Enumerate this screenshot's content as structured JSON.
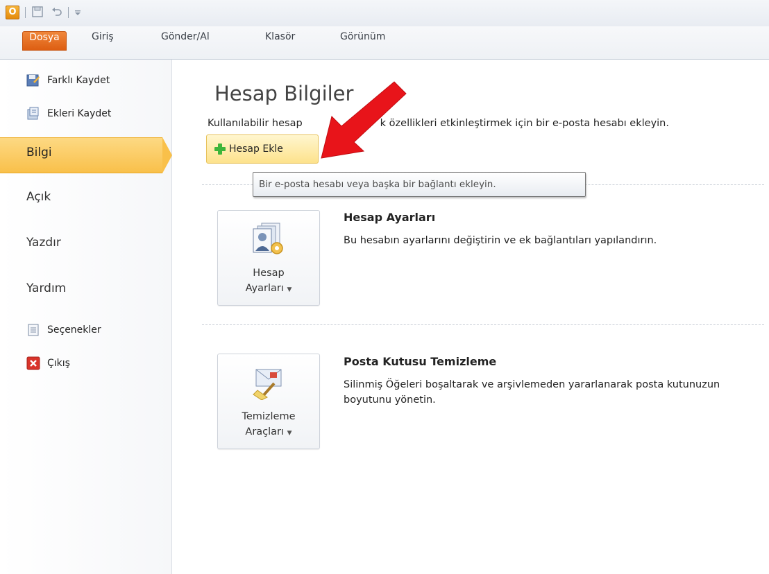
{
  "quick_access": {
    "app_logo_letter": "O",
    "icons": [
      "save-icon",
      "undo-icon",
      "customize-qat-icon"
    ]
  },
  "ribbon": {
    "tabs": [
      {
        "label": "Dosya"
      },
      {
        "label": "Giriş"
      },
      {
        "label": "Gönder/Al"
      },
      {
        "label": "Klasör"
      },
      {
        "label": "Görünüm"
      }
    ]
  },
  "nav": {
    "commands": [
      {
        "label": "Farklı Kaydet",
        "icon": "save-as-icon"
      },
      {
        "label": "Ekleri Kaydet",
        "icon": "save-attachments-icon"
      }
    ],
    "tabs": [
      {
        "label": "Bilgi",
        "selected": true
      },
      {
        "label": "Açık"
      },
      {
        "label": "Yazdır"
      },
      {
        "label": "Yardım"
      }
    ],
    "footer": [
      {
        "label": "Seçenekler",
        "icon": "options-icon"
      },
      {
        "label": "Çıkış",
        "icon": "exit-icon"
      }
    ]
  },
  "main": {
    "title": "Hesap Bilgiler",
    "subtitle": "Kullanılabilir hesap ... k özellikleri etkinleştirmek için bir e-posta hesabı ekleyin.",
    "subtitle_left": "Kullanılabilir hesap",
    "subtitle_right": "k özellikleri etkinleştirmek için bir e-posta hesabı ekleyin.",
    "add_account_label": "Hesap Ekle",
    "tooltip": "Bir e-posta hesabı veya başka bir bağlantı ekleyin.",
    "sections": [
      {
        "button_label_line1": "Hesap",
        "button_label_line2": "Ayarları",
        "title": "Hesap Ayarları",
        "description": "Bu hesabın ayarlarını değiştirin ve ek bağlantıları yapılandırın."
      },
      {
        "button_label_line1": "Temizleme",
        "button_label_line2": "Araçları",
        "title": "Posta Kutusu Temizleme",
        "description": "Silinmiş Öğeleri boşaltarak ve arşivlemeden yararlanarak posta kutunuzun boyutunu yönetin."
      }
    ]
  },
  "colors": {
    "file_tab": "#dd5e12",
    "selected_nav": "#f9c04a",
    "annotation_arrow": "#e8141a",
    "add_icon": "#3db53a"
  }
}
